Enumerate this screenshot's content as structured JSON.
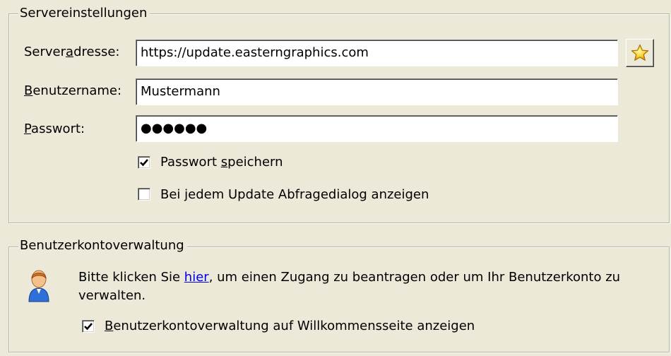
{
  "server": {
    "legend": "Servereinstellungen",
    "address_label_pre": "Server",
    "address_label_u": "a",
    "address_label_post": "dresse:",
    "address_value": "https://update.easterngraphics.com",
    "username_label_u": "B",
    "username_label_post": "enutzername:",
    "username_value": "Mustermann",
    "password_label_u": "P",
    "password_label_post": "asswort:",
    "password_value": "●●●●●●",
    "save_pw_pre": "Passwort ",
    "save_pw_u": "s",
    "save_pw_post": "peichern",
    "save_pw_checked": true,
    "ask_dialog_pre": "Bei ",
    "ask_dialog_u": "j",
    "ask_dialog_post": "edem Update Abfragedialog anzeigen",
    "ask_dialog_checked": false,
    "favorites_icon": "star-icon"
  },
  "account": {
    "legend": "Benutzerkontoverwaltung",
    "text_pre": "Bitte klicken Sie ",
    "link": "hier",
    "text_post": ", um einen Zugang zu beantragen oder um Ihr Benutzerkonto zu verwalten.",
    "show_pre": "",
    "show_u": "B",
    "show_post": "enutzerkontoverwaltung auf Willkommensseite anzeigen",
    "show_checked": true,
    "user_icon": "user-icon"
  }
}
